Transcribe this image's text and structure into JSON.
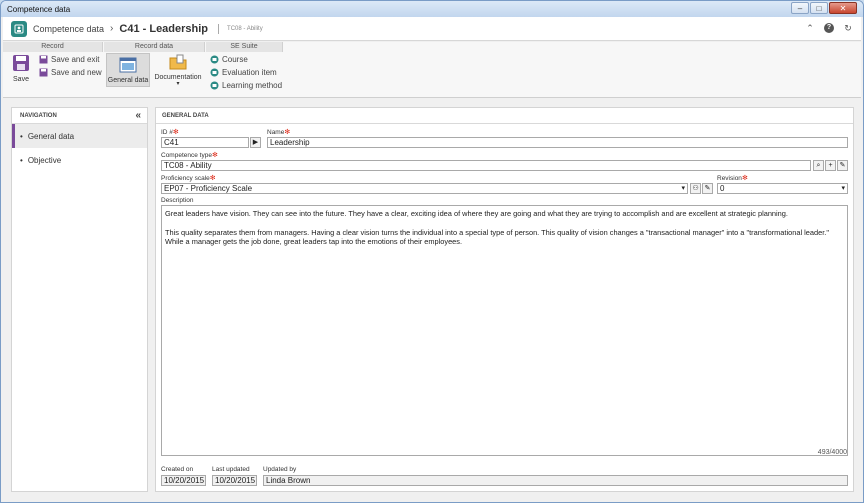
{
  "window": {
    "title": "Competence data"
  },
  "header": {
    "breadcrumb_root": "Competence data",
    "breadcrumb_separator": "›",
    "record_title": "C41 - Leadership",
    "record_subtitle": "TC08 - Ability"
  },
  "ribbon": {
    "groups": {
      "record": "Record",
      "record_data": "Record data",
      "se_suite": "SE Suite"
    },
    "save": "Save",
    "save_and_exit": "Save and exit",
    "save_and_new": "Save and new",
    "general_data": "General data",
    "documentation": "Documentation",
    "course": "Course",
    "evaluation_item": "Evaluation item",
    "learning_method": "Learning method"
  },
  "navigation": {
    "title": "NAVIGATION",
    "items": [
      {
        "label": "General data",
        "active": true
      },
      {
        "label": "Objective",
        "active": false
      }
    ]
  },
  "general_data": {
    "title": "GENERAL DATA",
    "id_label": "ID #",
    "id_value": "C41",
    "name_label": "Name",
    "name_value": "Leadership",
    "competence_type_label": "Competence type",
    "competence_type_value": "TC08 - Ability",
    "proficiency_scale_label": "Proficiency scale",
    "proficiency_scale_value": "EP07 - Proficiency Scale",
    "revision_label": "Revision",
    "revision_value": "0",
    "description_label": "Description",
    "description_p1": "Great leaders have vision. They can see into the future. They have a clear, exciting idea of where they are going and what they are trying to accomplish and are excellent at strategic planning.",
    "description_p2": "This quality separates them from managers. Having a clear vision turns the individual into a special type of person. This quality of vision changes a \"transactional manager\" into a \"transformational leader.\" While a manager gets the job done, great leaders tap into the emotions of their employees.",
    "char_counter": "493/4000",
    "created_on_label": "Created on",
    "created_on_value": "10/20/2015",
    "last_updated_label": "Last updated",
    "last_updated_value": "10/20/2015",
    "updated_by_label": "Updated by",
    "updated_by_value": "Linda Brown"
  },
  "colors": {
    "accent_purple": "#7a4a9a",
    "required_red": "#dd3322",
    "logo_teal": "#2a8a84"
  }
}
